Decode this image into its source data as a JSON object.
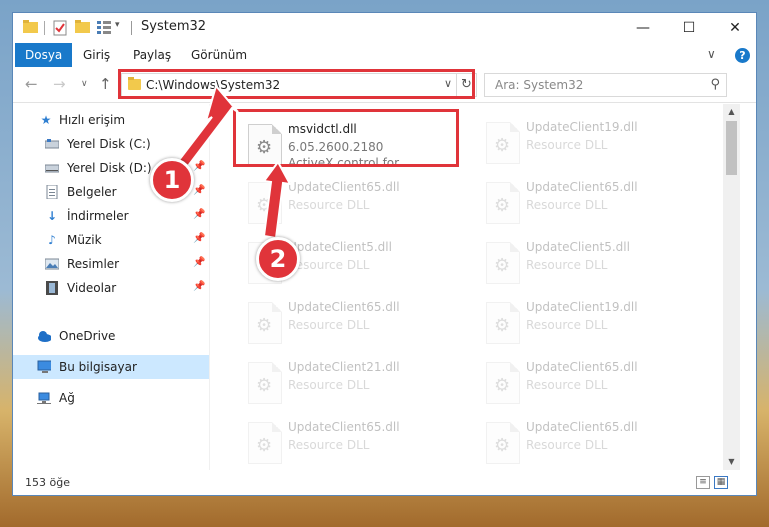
{
  "window": {
    "title": "System32"
  },
  "ribbon": {
    "tabs": [
      "Dosya",
      "Giriş",
      "Paylaş",
      "Görünüm"
    ]
  },
  "address": {
    "path": "C:\\Windows\\System32"
  },
  "search": {
    "placeholder": "Ara: System32"
  },
  "sidebar": {
    "items": [
      {
        "label": "Hızlı erişim",
        "icon": "star-icon"
      },
      {
        "label": "Yerel Disk (C:)",
        "icon": "drive-icon",
        "pinned": true
      },
      {
        "label": "Yerel Disk (D:)",
        "icon": "drive-icon",
        "pinned": true
      },
      {
        "label": "Belgeler",
        "icon": "documents-icon",
        "pinned": true
      },
      {
        "label": "İndirmeler",
        "icon": "downloads-icon",
        "pinned": true
      },
      {
        "label": "Müzik",
        "icon": "music-icon",
        "pinned": true
      },
      {
        "label": "Resimler",
        "icon": "pictures-icon",
        "pinned": true
      },
      {
        "label": "Videolar",
        "icon": "videos-icon",
        "pinned": true
      },
      {
        "label": "OneDrive",
        "icon": "cloud-icon"
      },
      {
        "label": "Bu bilgisayar",
        "icon": "computer-icon",
        "selected": true
      },
      {
        "label": "Ağ",
        "icon": "network-icon"
      }
    ]
  },
  "files": {
    "highlighted": {
      "name": "msvidctl.dll",
      "version": "6.05.2600.2180",
      "description": "ActiveX control for..."
    },
    "left_column": [
      {
        "name": "UpdateClient65.dll",
        "type": "Resource DLL"
      },
      {
        "name": "UpdateClient5.dll",
        "type": "Resource DLL"
      },
      {
        "name": "UpdateClient65.dll",
        "type": "Resource DLL"
      },
      {
        "name": "UpdateClient21.dll",
        "type": "Resource DLL"
      },
      {
        "name": "UpdateClient65.dll",
        "type": "Resource DLL"
      }
    ],
    "right_column": [
      {
        "name": "UpdateClient19.dll",
        "type": "Resource DLL"
      },
      {
        "name": "UpdateClient65.dll",
        "type": "Resource DLL"
      },
      {
        "name": "UpdateClient5.dll",
        "type": "Resource DLL"
      },
      {
        "name": "UpdateClient19.dll",
        "type": "Resource DLL"
      },
      {
        "name": "UpdateClient65.dll",
        "type": "Resource DLL"
      },
      {
        "name": "UpdateClient65.dll",
        "type": "Resource DLL"
      }
    ]
  },
  "status": {
    "count": "153 öğe"
  },
  "annotations": {
    "step1": "1",
    "step2": "2",
    "color": "#e0343a"
  }
}
